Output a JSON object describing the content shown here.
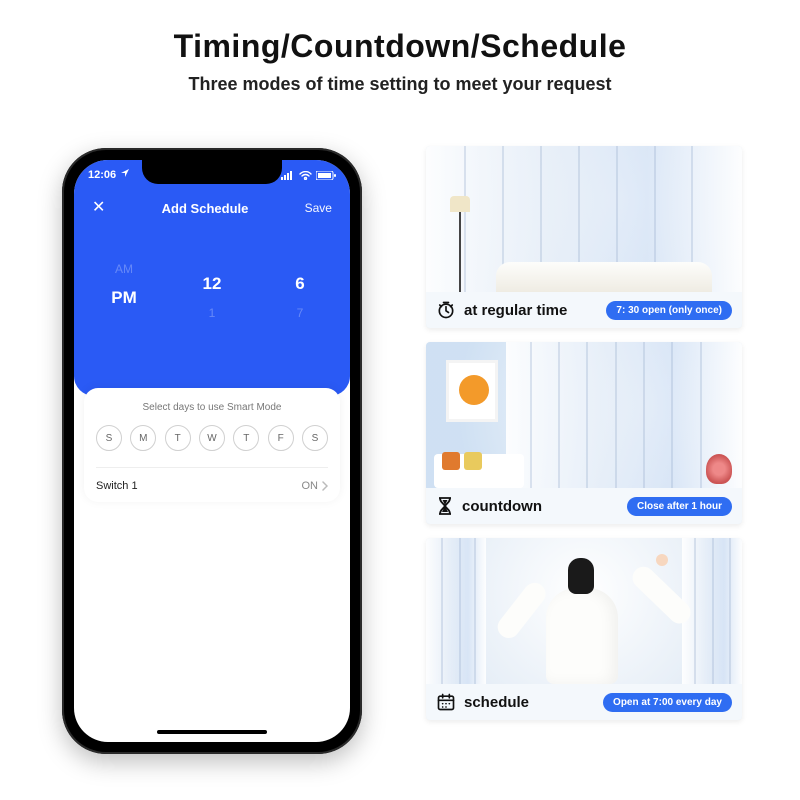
{
  "headline": "Timing/Countdown/Schedule",
  "subhead": "Three modes of time setting to meet your request",
  "phone": {
    "status": {
      "time": "12:06",
      "right_icons": [
        "cellular-icon",
        "wifi-icon",
        "battery-icon"
      ]
    },
    "header": {
      "close": "✕",
      "title": "Add Schedule",
      "save": "Save"
    },
    "picker": {
      "ampm": {
        "above": "AM",
        "sel": "PM",
        "below": ""
      },
      "hour": {
        "above": "",
        "sel": "12",
        "below": "1"
      },
      "minute": {
        "above": "",
        "sel": "6",
        "below": "7"
      }
    },
    "sheet": {
      "title": "Select days to use Smart Mode",
      "days": [
        "S",
        "M",
        "T",
        "W",
        "T",
        "F",
        "S"
      ],
      "row": {
        "label": "Switch 1",
        "value": "ON"
      }
    }
  },
  "cards": [
    {
      "icon": "clock-icon",
      "label": "at regular time",
      "pill": "7: 30 open (only once)"
    },
    {
      "icon": "hourglass-icon",
      "label": "countdown",
      "pill": "Close after 1 hour"
    },
    {
      "icon": "calendar-icon",
      "label": "schedule",
      "pill": "Open at 7:00 every day"
    }
  ]
}
